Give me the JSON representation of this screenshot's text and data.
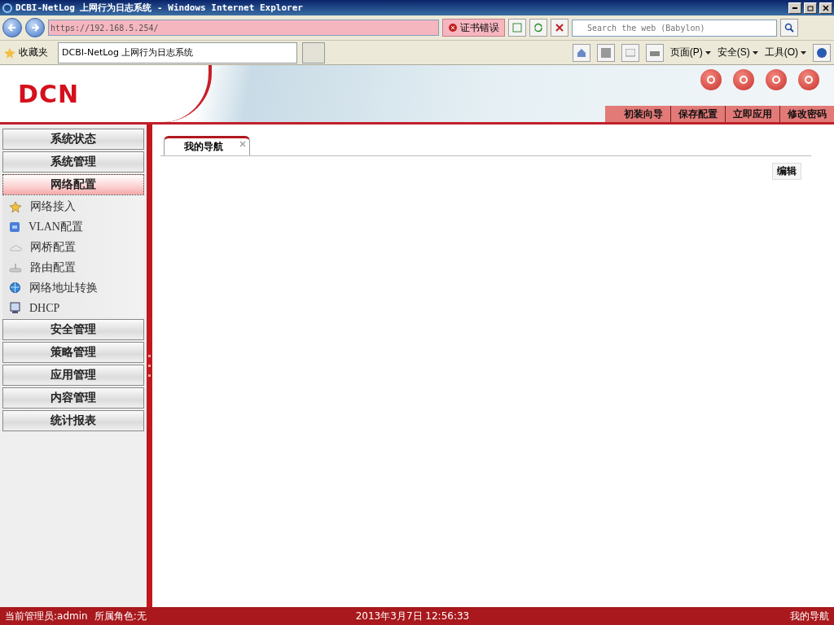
{
  "window": {
    "title": "DCBI-NetLog 上网行为日志系统 - Windows Internet Explorer"
  },
  "address_bar": {
    "url": "https://192.168.5.254/",
    "cert_error": "证书错误"
  },
  "search": {
    "placeholder": "Search the web (Babylon)"
  },
  "favorites": {
    "label": "收藏夹",
    "tab_title": "DCBI-NetLog 上网行为日志系统"
  },
  "command_bar": [
    "页面(P)",
    "安全(S)",
    "工具(O)"
  ],
  "header": {
    "logo": "DCN",
    "actions": [
      "初装向导",
      "保存配置",
      "立即应用",
      "修改密码"
    ]
  },
  "sidebar": {
    "groups": [
      {
        "label": "系统状态",
        "selected": false
      },
      {
        "label": "系统管理",
        "selected": false
      },
      {
        "label": "网络配置",
        "selected": true,
        "children": [
          "网络接入",
          "VLAN配置",
          "网桥配置",
          "路由配置",
          "网络地址转换",
          "DHCP"
        ]
      },
      {
        "label": "安全管理",
        "selected": false
      },
      {
        "label": "策略管理",
        "selected": false
      },
      {
        "label": "应用管理",
        "selected": false
      },
      {
        "label": "内容管理",
        "selected": false
      },
      {
        "label": "统计报表",
        "selected": false
      }
    ]
  },
  "content": {
    "tabs": [
      {
        "label": "我的导航",
        "selected": true
      }
    ],
    "edit_button": "编辑"
  },
  "status_bar": {
    "admin": "当前管理员:admin",
    "role": "所属角色:无",
    "datetime": "2013年3月7日 12:56:33",
    "right": "我的导航"
  }
}
